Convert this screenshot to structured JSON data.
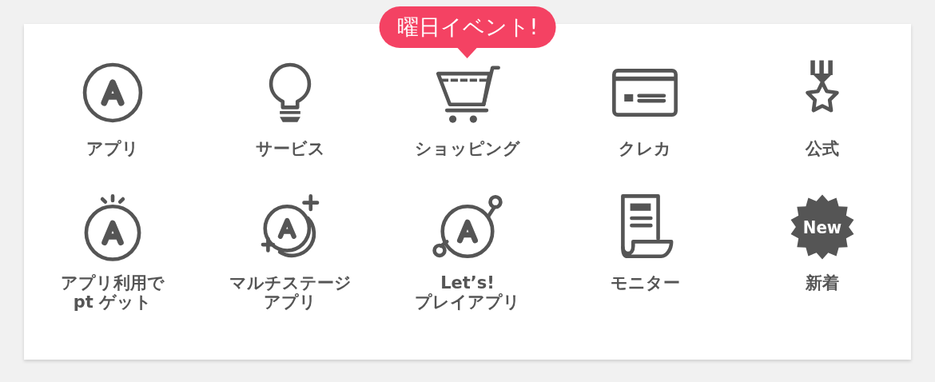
{
  "menu": {
    "items": [
      {
        "kind": "app",
        "label_lines": [
          "アプリ"
        ]
      },
      {
        "kind": "bulb",
        "label_lines": [
          "サービス"
        ]
      },
      {
        "kind": "cart",
        "label_lines": [
          "ショッピング"
        ],
        "badge": "曜日イベント!"
      },
      {
        "kind": "card",
        "label_lines": [
          "クレカ"
        ]
      },
      {
        "kind": "medal",
        "label_lines": [
          "公式"
        ]
      },
      {
        "kind": "sparkle",
        "label_lines": [
          "アプリ利用で",
          "pt ゲット"
        ]
      },
      {
        "kind": "multi",
        "label_lines": [
          "マルチステージ",
          "アプリ"
        ]
      },
      {
        "kind": "orbit",
        "label_lines": [
          "Let’s!",
          "プレイアプリ"
        ]
      },
      {
        "kind": "document",
        "label_lines": [
          "モニター"
        ]
      },
      {
        "kind": "starburst",
        "icon_text": "New",
        "label_lines": [
          "新着"
        ]
      }
    ]
  }
}
